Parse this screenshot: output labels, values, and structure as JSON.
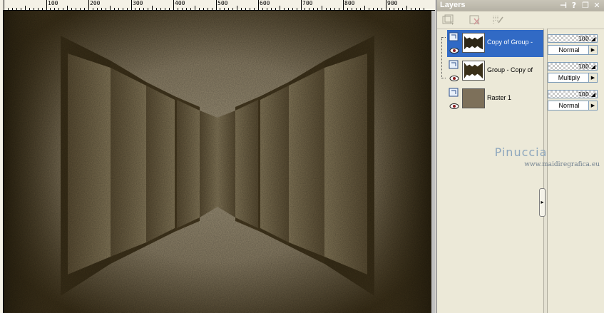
{
  "ruler": {
    "labels": [
      "100",
      "200",
      "300",
      "400",
      "500",
      "600",
      "700",
      "800",
      "900"
    ]
  },
  "layers_panel": {
    "title": "Layers",
    "layers": [
      {
        "name": "Copy of Group -",
        "opacity": "100",
        "blend_mode": "Normal",
        "selected": true
      },
      {
        "name": "Group - Copy of",
        "opacity": "100",
        "blend_mode": "Multiply",
        "selected": false
      },
      {
        "name": "Raster 1",
        "opacity": "100",
        "blend_mode": "Normal",
        "selected": false
      }
    ]
  },
  "watermark": {
    "name": "Pinuccia",
    "url": "www.maidiregrafica.eu"
  },
  "colors": {
    "selection": "#316ac5",
    "panel_bg": "#ece9d8",
    "canvas_light": "#9c9077",
    "canvas_dark": "#2f2612",
    "raster_thumb": "#7d705a"
  }
}
